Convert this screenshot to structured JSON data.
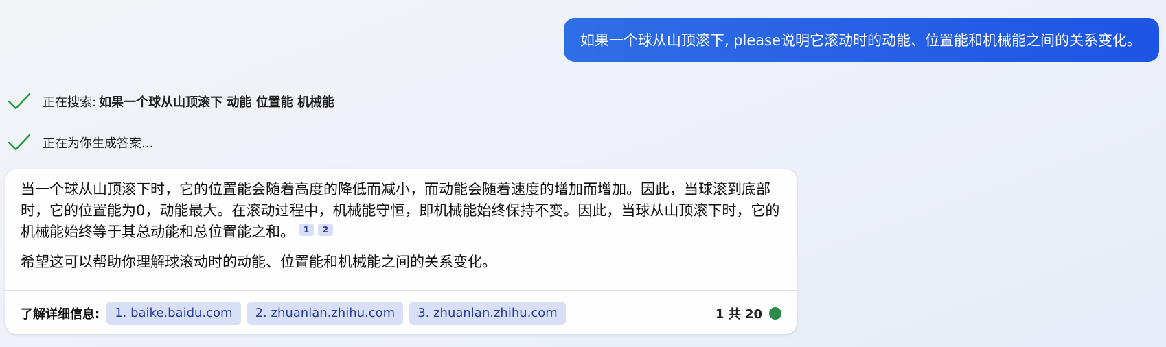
{
  "user_message": {
    "text": "如果一个球从山顶滚下, please说明它滚动时的动能、位置能和机械能之间的关系变化。"
  },
  "steps": [
    {
      "prefix": "正在搜索: ",
      "query": "如果一个球从山顶滚下 动能 位置能 机械能",
      "icon": "checkmark-icon"
    },
    {
      "prefix": "正在为你生成答案...",
      "query": "",
      "icon": "checkmark-icon"
    }
  ],
  "answer": {
    "paragraph_1": "当一个球从山顶滚下时，它的位置能会随着高度的降低而减小，而动能会随着速度的增加而增加。因此，当球滚到底部时，它的位置能为0，动能最大。在滚动过程中，机械能守恒，即机械能始终保持不变。因此，当球从山顶滚下时，它的机械能始终等于其总动能和总位置能之和。",
    "citations": [
      "1",
      "2"
    ],
    "paragraph_2": "希望这可以帮助你理解球滚动时的动能、位置能和机械能之间的关系变化。"
  },
  "footer": {
    "learn_more_label": "了解详细信息:",
    "links": [
      "1. baike.baidu.com",
      "2. zhuanlan.zhihu.com",
      "3. zhuanlan.zhihu.com"
    ],
    "counter": "1 共 20",
    "status_color": "#2e8b4a"
  },
  "colors": {
    "user_bubble": "#1d55e4",
    "check": "#1f9e3a",
    "chip_bg": "#d8e0f8",
    "chip_text": "#2a3c9e"
  }
}
